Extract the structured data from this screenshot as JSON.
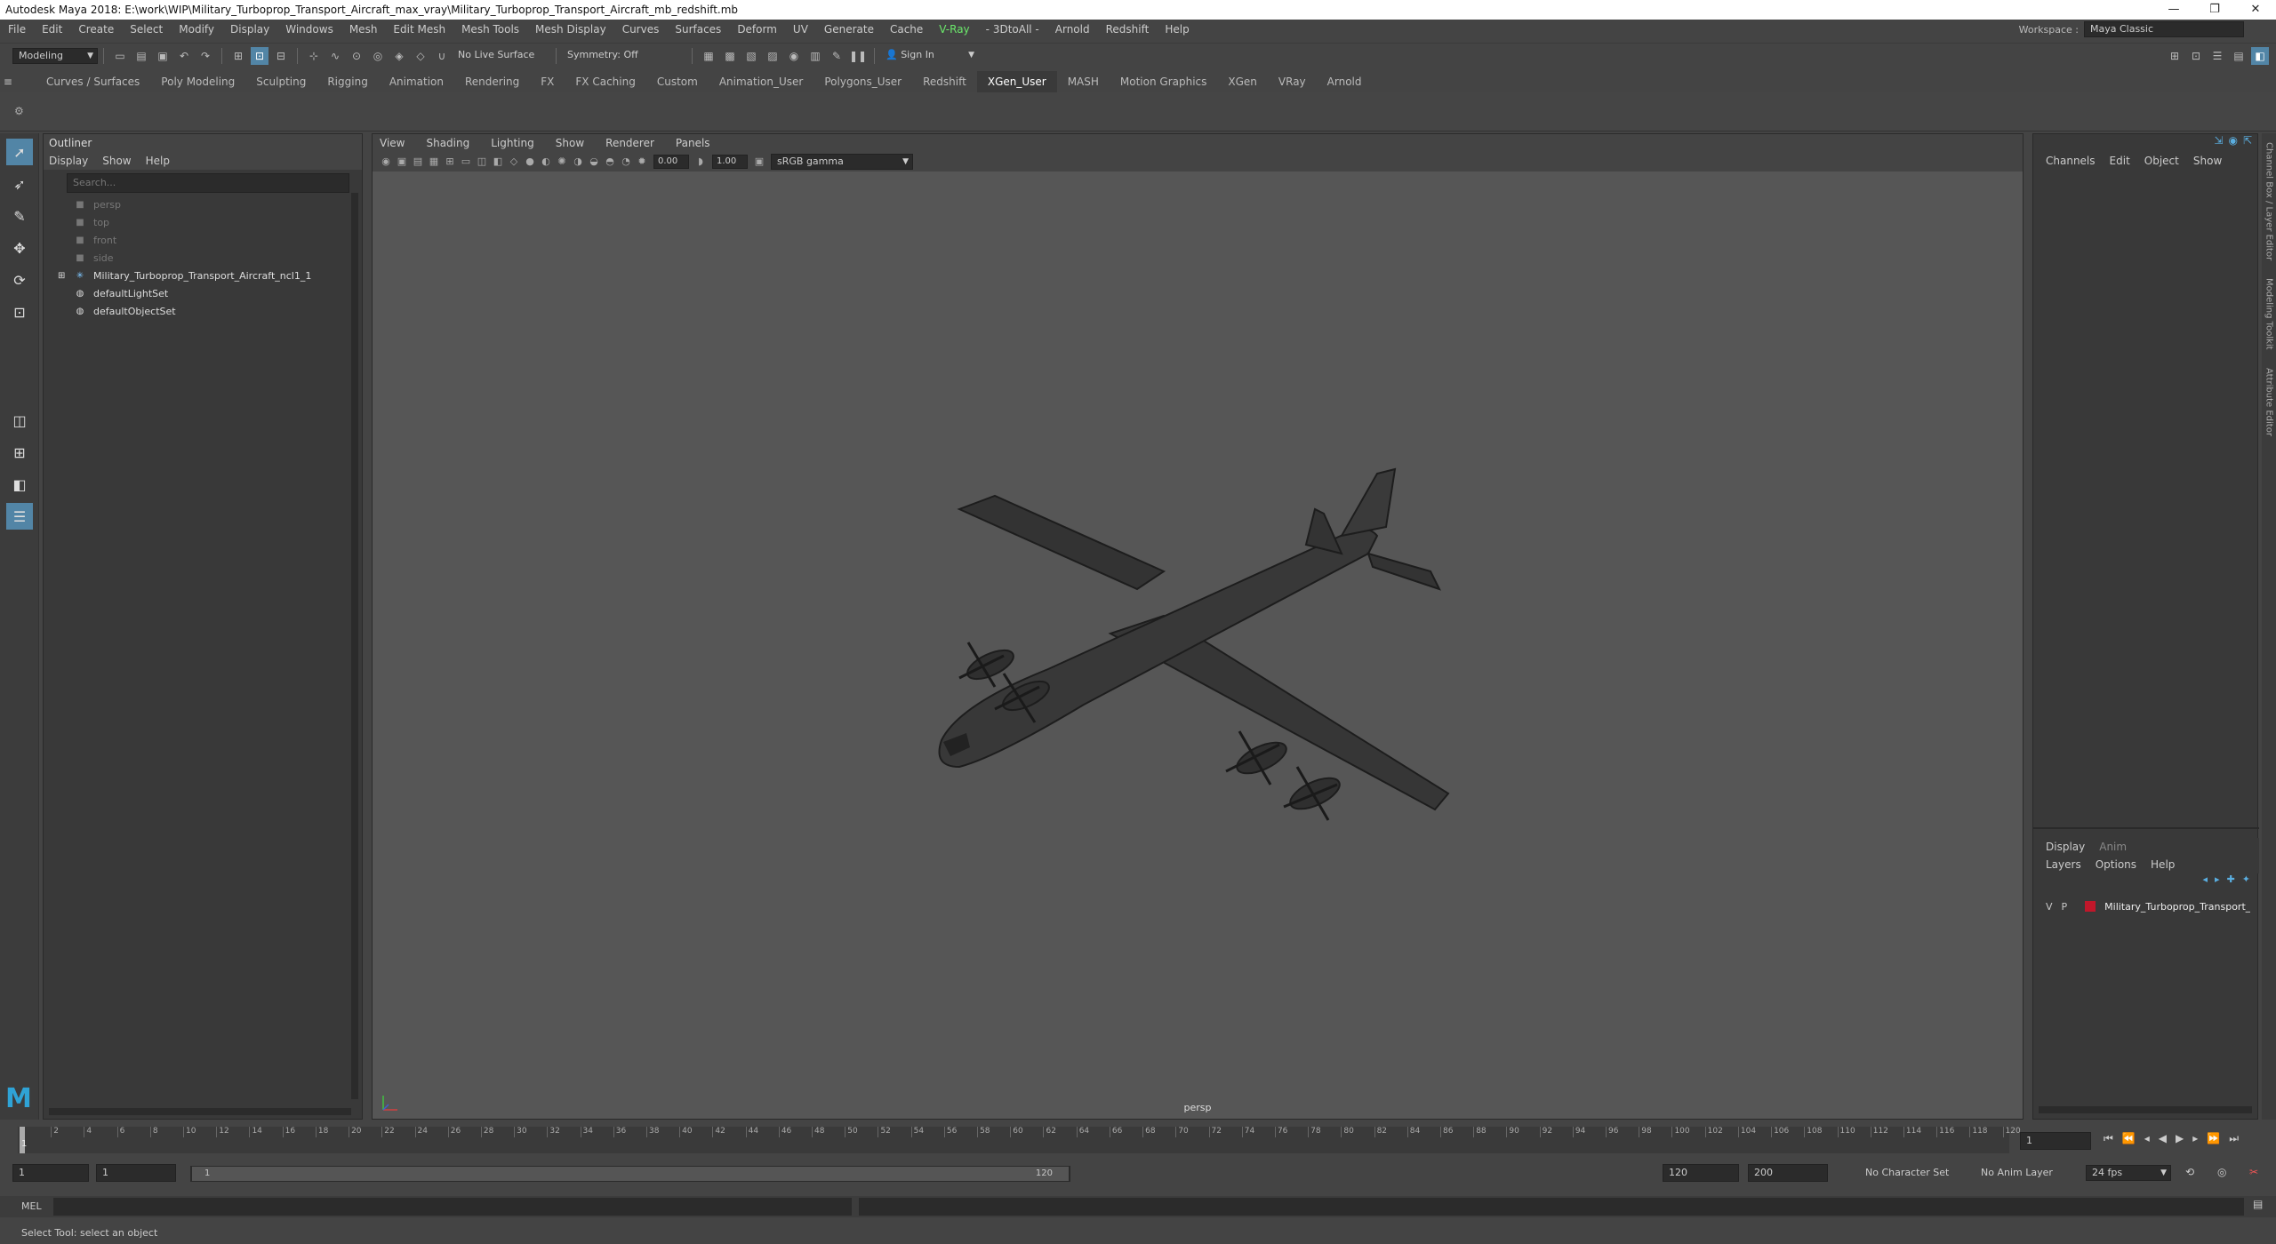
{
  "title": "Autodesk Maya 2018: E:\\work\\WIP\\Military_Turboprop_Transport_Aircraft_max_vray\\Military_Turboprop_Transport_Aircraft_mb_redshift.mb",
  "menu": [
    "File",
    "Edit",
    "Create",
    "Select",
    "Modify",
    "Display",
    "Windows",
    "Mesh",
    "Edit Mesh",
    "Mesh Tools",
    "Mesh Display",
    "Curves",
    "Surfaces",
    "Deform",
    "UV",
    "Generate",
    "Cache",
    "V-Ray",
    "- 3DtoAll -",
    "Arnold",
    "Redshift",
    "Help"
  ],
  "workspace": {
    "label": "Workspace :",
    "value": "Maya Classic"
  },
  "status": {
    "mode": "Modeling",
    "live_surface": "No Live Surface",
    "symmetry": "Symmetry: Off",
    "sign_in": "Sign In"
  },
  "shelf_tabs": [
    "Curves / Surfaces",
    "Poly Modeling",
    "Sculpting",
    "Rigging",
    "Animation",
    "Rendering",
    "FX",
    "FX Caching",
    "Custom",
    "Animation_User",
    "Polygons_User",
    "Redshift",
    "XGen_User",
    "MASH",
    "Motion Graphics",
    "XGen",
    "VRay",
    "Arnold"
  ],
  "active_shelf": "XGen_User",
  "outliner": {
    "title": "Outliner",
    "menu": [
      "Display",
      "Show",
      "Help"
    ],
    "search_placeholder": "Search...",
    "items": [
      {
        "label": "persp",
        "dim": true,
        "icon": "camera-icon"
      },
      {
        "label": "top",
        "dim": true,
        "icon": "camera-icon"
      },
      {
        "label": "front",
        "dim": true,
        "icon": "camera-icon"
      },
      {
        "label": "side",
        "dim": true,
        "icon": "camera-icon"
      },
      {
        "label": "Military_Turboprop_Transport_Aircraft_ncl1_1",
        "dim": false,
        "icon": "group-icon"
      },
      {
        "label": "defaultLightSet",
        "dim": false,
        "icon": "set-icon"
      },
      {
        "label": "defaultObjectSet",
        "dim": false,
        "icon": "set-icon"
      }
    ]
  },
  "viewport": {
    "menu": [
      "View",
      "Shading",
      "Lighting",
      "Show",
      "Renderer",
      "Panels"
    ],
    "exposure": "0.00",
    "gamma": "1.00",
    "color_space": "sRGB gamma",
    "camera_label": "persp"
  },
  "channel_box": {
    "menu": [
      "Channels",
      "Edit",
      "Object",
      "Show"
    ]
  },
  "layer_editor": {
    "tabs": [
      "Display",
      "Anim"
    ],
    "menu": [
      "Layers",
      "Options",
      "Help"
    ],
    "layer": {
      "v": "V",
      "p": "P",
      "name": "Military_Turboprop_Transport_",
      "color": "#c0172a"
    }
  },
  "side_tabs": [
    "Channel Box / Layer Editor",
    "Modeling Toolkit",
    "Attribute Editor"
  ],
  "timeline": {
    "ticks": [
      "2",
      "4",
      "6",
      "8",
      "10",
      "12",
      "14",
      "16",
      "18",
      "20",
      "22",
      "24",
      "26",
      "28",
      "30",
      "32",
      "34",
      "36",
      "38",
      "40",
      "42",
      "44",
      "46",
      "48",
      "50",
      "52",
      "54",
      "56",
      "58",
      "60",
      "62",
      "64",
      "66",
      "68",
      "70",
      "72",
      "74",
      "76",
      "78",
      "80",
      "82",
      "84",
      "86",
      "88",
      "90",
      "92",
      "94",
      "96",
      "98",
      "100",
      "102",
      "104",
      "106",
      "108",
      "110",
      "112",
      "114",
      "116",
      "118",
      "120"
    ],
    "current_frame": "1",
    "playhead_label": "1"
  },
  "range": {
    "start": "1",
    "anim_start": "1",
    "range_start": "1",
    "range_end": "120",
    "end": "120",
    "anim_end": "200",
    "character_set": "No Character Set",
    "anim_layer": "No Anim Layer",
    "fps": "24 fps"
  },
  "command_line": {
    "label": "MEL"
  },
  "help_line": "Select Tool: select an object"
}
